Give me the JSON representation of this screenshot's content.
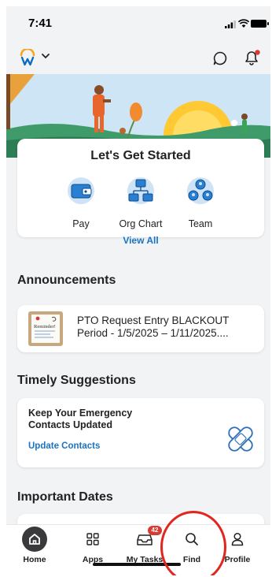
{
  "status_bar": {
    "time": "7:41"
  },
  "quick_actions": {
    "title": "Let's Get Started",
    "items": [
      {
        "label": "Pay",
        "icon": "wallet-icon"
      },
      {
        "label": "Org Chart",
        "icon": "org-chart-icon"
      },
      {
        "label": "Team",
        "icon": "team-icon"
      }
    ],
    "view_all": "View All"
  },
  "announcements": {
    "title": "Announcements",
    "items": [
      {
        "text": "PTO Request Entry BLACKOUT Period - 1/5/2025 – 1/11/2025....",
        "thumb_note": "Reminder!"
      }
    ]
  },
  "timely_suggestions": {
    "title": "Timely Suggestions",
    "items": [
      {
        "text": "Keep Your Emergency Contacts Updated",
        "action": "Update Contacts",
        "icon": "bandage-icon"
      }
    ]
  },
  "important_dates": {
    "title": "Important Dates"
  },
  "bottom_nav": {
    "items": [
      {
        "label": "Home",
        "icon": "home-icon",
        "active": true
      },
      {
        "label": "Apps",
        "icon": "apps-grid-icon"
      },
      {
        "label": "My Tasks",
        "icon": "inbox-icon",
        "badge": "42"
      },
      {
        "label": "Find",
        "icon": "search-icon"
      },
      {
        "label": "Profile",
        "icon": "user-icon"
      }
    ]
  },
  "colors": {
    "accent_link": "#1a73c4",
    "badge": "#d93a30",
    "annotation_circle": "#e2251e",
    "logo_orange": "#f5a623",
    "logo_blue": "#0b6cbd"
  }
}
